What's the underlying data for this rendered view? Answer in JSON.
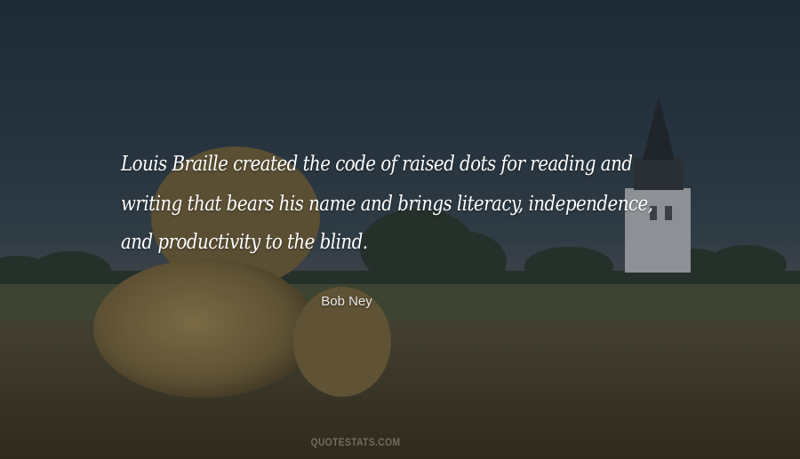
{
  "quote": {
    "lines": [
      "Louis Braille created the code of raised dots for reading and",
      "writing that bears his name and brings literacy, independence,",
      "and productivity to the blind."
    ],
    "author": "Bob Ney"
  },
  "watermark": "QUOTESTATS.COM",
  "colors": {
    "sky": "#1e2a35",
    "field": "#3e3a2a",
    "hay": "#6a5b3a",
    "text": "#ffffff"
  }
}
